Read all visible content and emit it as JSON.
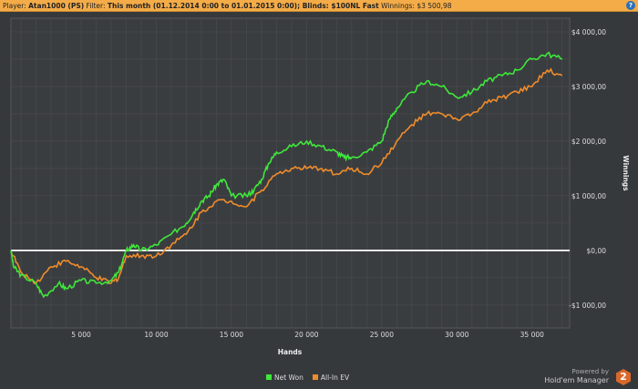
{
  "header": {
    "player_label": "Player:",
    "player": "Atan1000 (PS)",
    "filter_label": "Filter:",
    "filter": "This month (01.12.2014 0:00 to 01.01.2015 0:00); Blinds: $100NL Fast",
    "winnings_label": "Winnings:",
    "winnings": "$3 500,98",
    "help": "?"
  },
  "brand": {
    "powered": "Powered by",
    "name": "Hold'em Manager",
    "logo": "2"
  },
  "colors": {
    "net_won": "#3ee83a",
    "all_in_ev": "#f08c2a",
    "header": "#f4ac48"
  },
  "chart_data": {
    "type": "line",
    "title": "",
    "xlabel": "Hands",
    "ylabel": "Winnings",
    "xlim": [
      330,
      37500
    ],
    "ylim": [
      -1420,
      4250
    ],
    "xticks": [
      5000,
      10000,
      15000,
      20000,
      25000,
      30000,
      35000
    ],
    "xtick_labels": [
      "5 000",
      "10 000",
      "15 000",
      "20 000",
      "25 000",
      "30 000",
      "35 000"
    ],
    "yticks": [
      -1000,
      0,
      1000,
      2000,
      3000,
      4000
    ],
    "ytick_labels": [
      "-$1 000,00",
      "$0,00",
      "$1 000,00",
      "$2 000,00",
      "$3 000,00",
      "$4 000,00"
    ],
    "legend": "bottom-center",
    "series": [
      {
        "name": "Net Won",
        "x": [
          330,
          500,
          1000,
          2000,
          2500,
          3500,
          4000,
          5000,
          6000,
          7000,
          7500,
          8000,
          8500,
          9000,
          10000,
          11000,
          12000,
          12500,
          13000,
          13500,
          14000,
          14500,
          15000,
          16000,
          16500,
          17000,
          17500,
          18000,
          19000,
          20000,
          21000,
          22000,
          22500,
          23000,
          24000,
          25000,
          25500,
          26000,
          27000,
          28000,
          29000,
          30000,
          31000,
          32000,
          33000,
          34000,
          35000,
          36000,
          37000
        ],
        "y": [
          0,
          -300,
          -450,
          -600,
          -850,
          -600,
          -700,
          -550,
          -600,
          -550,
          -400,
          0,
          100,
          0,
          100,
          300,
          500,
          700,
          900,
          1000,
          1200,
          1300,
          1000,
          1000,
          1100,
          1300,
          1600,
          1800,
          1900,
          2000,
          1900,
          1800,
          1700,
          1700,
          1800,
          2000,
          2400,
          2600,
          2900,
          3100,
          3000,
          2800,
          2900,
          3100,
          3200,
          3300,
          3500,
          3600,
          3500
        ]
      },
      {
        "name": "All-In EV",
        "x": [
          330,
          1000,
          2000,
          3000,
          4000,
          5000,
          6000,
          7000,
          7500,
          8000,
          9000,
          10000,
          11000,
          12000,
          13000,
          14000,
          15000,
          16000,
          17000,
          18000,
          19000,
          20000,
          21000,
          22000,
          23000,
          24000,
          25000,
          26000,
          27000,
          28000,
          29000,
          30000,
          31000,
          32000,
          33000,
          34000,
          35000,
          36000,
          37000
        ],
        "y": [
          0,
          -400,
          -600,
          -300,
          -200,
          -300,
          -500,
          -600,
          -500,
          -100,
          -100,
          -100,
          100,
          300,
          700,
          900,
          900,
          800,
          1100,
          1400,
          1500,
          1500,
          1500,
          1400,
          1500,
          1400,
          1600,
          2000,
          2300,
          2500,
          2500,
          2400,
          2500,
          2700,
          2800,
          2900,
          3000,
          3300,
          3200
        ]
      }
    ]
  }
}
